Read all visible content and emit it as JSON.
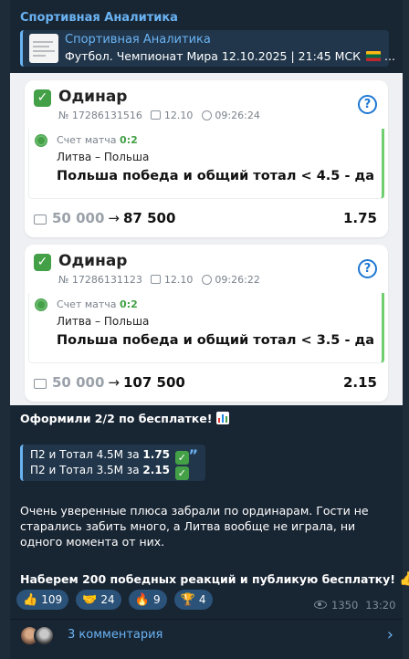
{
  "post": {
    "author": "Спортивная Аналитика",
    "reply": {
      "title": "Спортивная Аналитика",
      "text": "Футбол. Чемпионат Мира 12.10.2025 | 21:45 МСК",
      "suffix": "..."
    },
    "caption_title": "Оформили 2/2 по бесплатке!",
    "quote": {
      "line1_prefix": "П2 и Тотал 4.5М за",
      "line1_odds": "1.75",
      "line2_prefix": "П2 и Тотал 3.5М за",
      "line2_odds": "2.15"
    },
    "paragraph": "Очень уверенные плюса забрали по ординарам. Гости не старались забить много, а Литва вообще не играла, ни одного момента от них.",
    "call_to_action": "Наберем 200 победных реакций и публикую бесплатку!",
    "reactions": [
      {
        "emoji": "👍",
        "count": "109"
      },
      {
        "emoji": "🤝",
        "count": "24"
      },
      {
        "emoji": "🔥",
        "count": "9"
      },
      {
        "emoji": "🏆",
        "count": "4"
      }
    ],
    "views": "1350",
    "time": "13:20",
    "comments_label": "3 комментария"
  },
  "bets": [
    {
      "title": "Одинар",
      "number": "№ 17286131516",
      "date": "12.10",
      "time": "09:26:24",
      "score_label": "Счет матча",
      "score": "0:2",
      "teams": "Литва – Польша",
      "bet": "Польша победа и общий тотал < 4.5 - да",
      "stake": "50 000",
      "win": "87 500",
      "coef": "1.75"
    },
    {
      "title": "Одинар",
      "number": "№ 17286131123",
      "date": "12.10",
      "time": "09:26:22",
      "score_label": "Счет матча",
      "score": "0:2",
      "teams": "Литва – Польша",
      "bet": "Польша победа и общий тотал < 3.5 - да",
      "stake": "50 000",
      "win": "107 500",
      "coef": "2.15"
    }
  ],
  "colors": {
    "accent": "#6ab3f3",
    "win_green": "#43a047",
    "reaction_bg": "#2b5278"
  }
}
